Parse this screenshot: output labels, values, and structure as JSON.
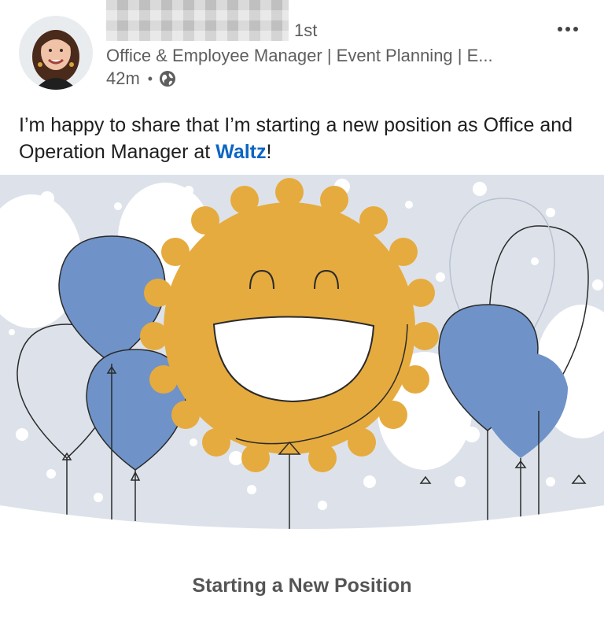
{
  "author": {
    "connection_degree": "1st",
    "headline": "Office & Employee Manager | Event Planning | E...",
    "time_ago": "42m",
    "separator": "•",
    "visibility_icon": "globe-icon"
  },
  "menu": {
    "icon": "more-icon"
  },
  "post": {
    "text_before_link": "I’m happy to share that I’m starting a new position as Office and Operation Manager at ",
    "company_link": "Waltz",
    "text_after_link": "!"
  },
  "card": {
    "caption": "Starting a New Position"
  },
  "colors": {
    "link": "#0a66c2",
    "balloon_blue": "#6f93c8",
    "sun_yellow": "#e6ab3e",
    "illustration_bg": "#dde2ea"
  }
}
